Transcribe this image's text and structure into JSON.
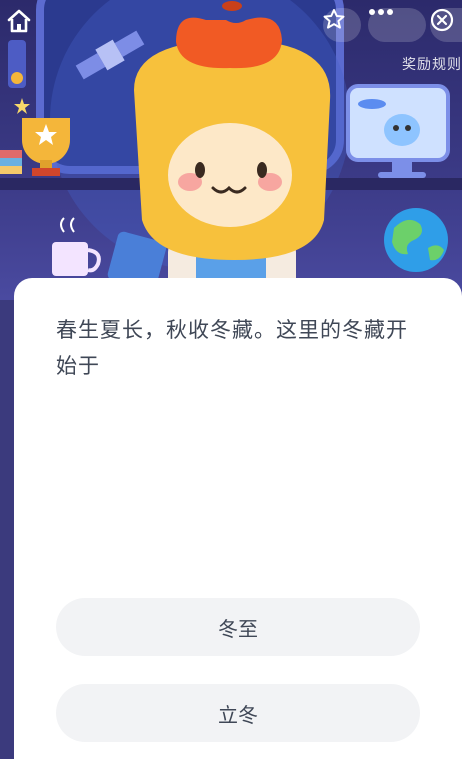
{
  "header": {
    "reward_rules": "奖励规则"
  },
  "icons": {
    "home": "home-icon",
    "favorite": "star-icon",
    "more": "more-icon",
    "close": "close-icon"
  },
  "question": {
    "text": "春生夏长，秋收冬藏。这里的冬藏开始于"
  },
  "options": [
    {
      "label": "冬至"
    },
    {
      "label": "立冬"
    }
  ],
  "colors": {
    "scene_bg": "#2c2a6b",
    "card_bg": "#ffffff",
    "option_bg": "#f2f3f5",
    "text": "#3f4756",
    "mascot": "#f7c13c",
    "apple": "#f15a24"
  }
}
